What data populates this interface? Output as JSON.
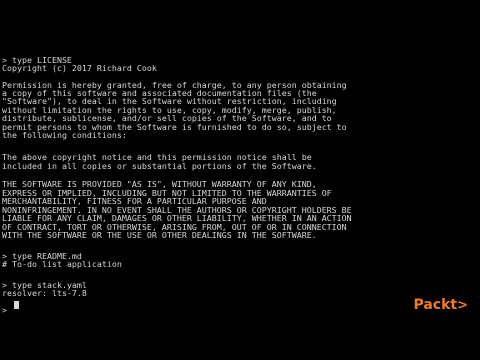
{
  "terminal": {
    "lines": [
      "> type LICENSE",
      "Copyright (c) 2017 Richard Cook",
      "",
      "Permission is hereby granted, free of charge, to any person obtaining",
      "a copy of this software and associated documentation files (the",
      "\"Software\"), to deal in the Software without restriction, including",
      "without limitation the rights to use, copy, modify, merge, publish,",
      "distribute, sublicense, and/or sell copies of the Software, and to",
      "permit persons to whom the Software is furnished to do so, subject to",
      "the following conditions:",
      "",
      "The above copyright notice and this permission notice shall be",
      "included in all copies or substantial portions of the Software.",
      "",
      "THE SOFTWARE IS PROVIDED \"AS IS\", WITHOUT WARRANTY OF ANY KIND,",
      "EXPRESS OR IMPLIED, INCLUDING BUT NOT LIMITED TO THE WARRANTIES OF",
      "MERCHANTABILITY, FITNESS FOR A PARTICULAR PURPOSE AND",
      "NONINFRINGEMENT. IN NO EVENT SHALL THE AUTHORS OR COPYRIGHT HOLDERS BE",
      "LIABLE FOR ANY CLAIM, DAMAGES OR OTHER LIABILITY, WHETHER IN AN ACTION",
      "OF CONTRACT, TORT OR OTHERWISE, ARISING FROM, OUT OF OR IN CONNECTION",
      "WITH THE SOFTWARE OR THE USE OR OTHER DEALINGS IN THE SOFTWARE.",
      "",
      "> type README.md",
      "# To-do list application",
      "",
      "> type stack.yaml",
      "resolver: lts-7.8",
      "",
      ">"
    ],
    "text_color": "#d8d8d8",
    "background_color": "#000000"
  },
  "watermark": {
    "label": "Packt",
    "symbol": ">",
    "color": "#f07c22"
  }
}
